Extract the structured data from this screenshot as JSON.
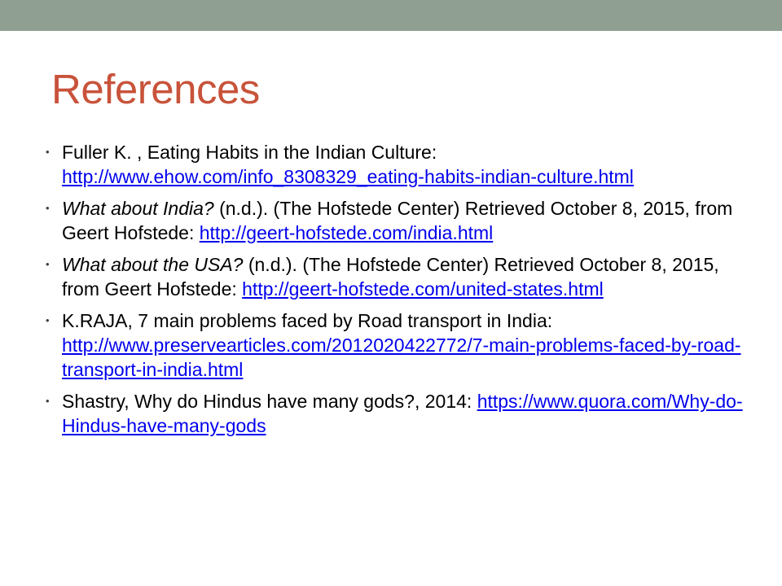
{
  "colors": {
    "top_bar": "#8fa092",
    "title": "#c8533a",
    "link": "#0000ee",
    "text": "#000000"
  },
  "slide": {
    "title": "References"
  },
  "references": [
    {
      "text": "Fuller K. , Eating Habits in the Indian Culture: ",
      "link": "http://www.ehow.com/info_8308329_eating-habits-indian-culture.html"
    },
    {
      "title_italic": "What about India?",
      "text": " (n.d.). (The Hofstede Center) Retrieved October 8, 2015, from Geert Hofstede: ",
      "link": "http://geert-hofstede.com/india.html"
    },
    {
      "title_italic": "What about the USA?",
      "text": " (n.d.). (The Hofstede Center) Retrieved October 8, 2015, from Geert Hofstede: ",
      "link": "http://geert-hofstede.com/united-states.html"
    },
    {
      "text": "K.RAJA, 7 main problems faced by Road transport in India: ",
      "link": "http://www.preservearticles.com/2012020422772/7-main-problems-faced-by-road-transport-in-india.html"
    },
    {
      "text": " Shastry, Why do Hindus have many gods?, 2014: ",
      "link": "https://www.quora.com/Why-do-Hindus-have-many-gods"
    }
  ]
}
